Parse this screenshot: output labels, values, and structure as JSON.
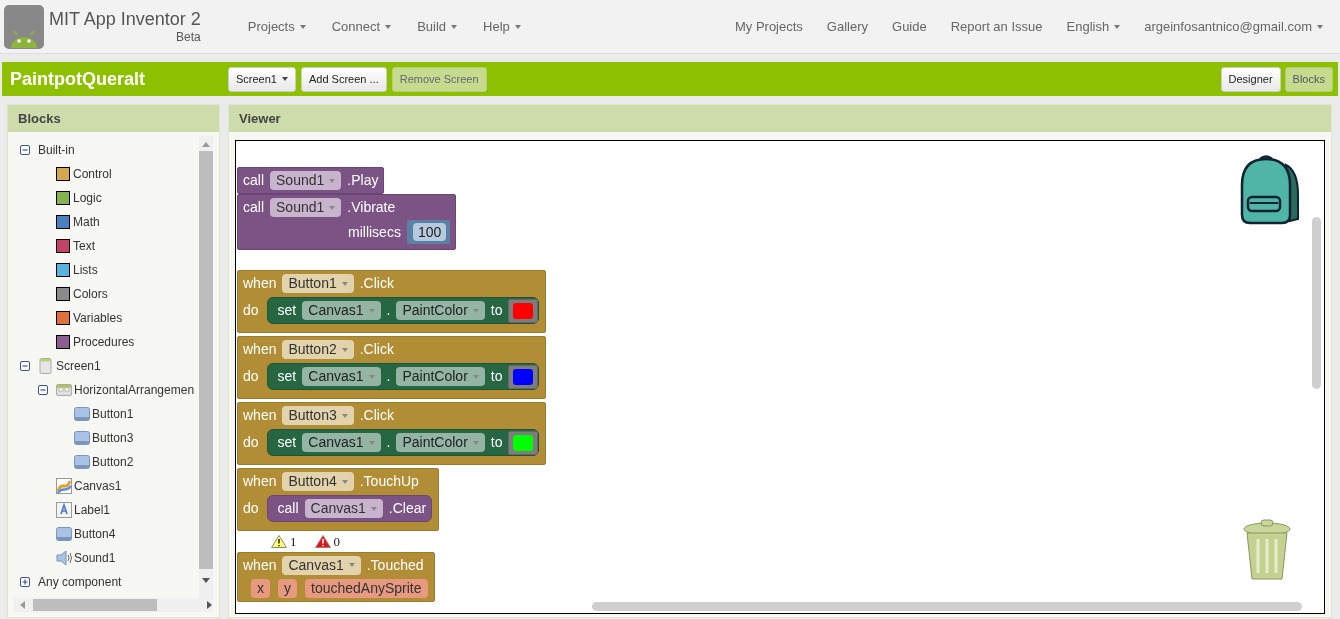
{
  "header": {
    "title": "MIT App Inventor 2",
    "subtitle": "Beta",
    "menus": [
      {
        "label": "Projects",
        "dropdown": true
      },
      {
        "label": "Connect",
        "dropdown": true
      },
      {
        "label": "Build",
        "dropdown": true
      },
      {
        "label": "Help",
        "dropdown": true
      }
    ],
    "links": [
      {
        "label": "My Projects",
        "dropdown": false
      },
      {
        "label": "Gallery",
        "dropdown": false
      },
      {
        "label": "Guide",
        "dropdown": false
      },
      {
        "label": "Report an Issue",
        "dropdown": false
      },
      {
        "label": "English",
        "dropdown": true
      },
      {
        "label": "argeinfosantnico@gmail.com",
        "dropdown": true
      }
    ]
  },
  "toolbar": {
    "project": "PaintpotQueralt",
    "buttons": [
      {
        "label": "Screen1",
        "dropdown": true,
        "disabled": false
      },
      {
        "label": "Add Screen ...",
        "dropdown": false,
        "disabled": false
      },
      {
        "label": "Remove Screen",
        "dropdown": false,
        "disabled": true
      }
    ],
    "views": [
      {
        "label": "Designer",
        "selected": false
      },
      {
        "label": "Blocks",
        "selected": true
      }
    ]
  },
  "blocks_panel": {
    "title": "Blocks",
    "tree": [
      {
        "label": "Built-in",
        "expanded": true,
        "children": [
          {
            "label": "Control",
            "color": "#d4a94b"
          },
          {
            "label": "Logic",
            "color": "#84b350"
          },
          {
            "label": "Math",
            "color": "#4a7fc1"
          },
          {
            "label": "Text",
            "color": "#c4416a"
          },
          {
            "label": "Lists",
            "color": "#55b3dd"
          },
          {
            "label": "Colors",
            "color": "#8a8a8a"
          },
          {
            "label": "Variables",
            "color": "#e06f3a"
          },
          {
            "label": "Procedures",
            "color": "#8c5f93"
          }
        ]
      },
      {
        "label": "Screen1",
        "kind": "screen",
        "expanded": true,
        "children": [
          {
            "label": "HorizontalArrangemen",
            "kind": "arrangement",
            "expanded": true,
            "children": [
              {
                "label": "Button1",
                "kind": "button"
              },
              {
                "label": "Button3",
                "kind": "button"
              },
              {
                "label": "Button2",
                "kind": "button"
              }
            ]
          },
          {
            "label": "Canvas1",
            "kind": "canvas"
          },
          {
            "label": "Label1",
            "kind": "label"
          },
          {
            "label": "Button4",
            "kind": "button"
          },
          {
            "label": "Sound1",
            "kind": "sound"
          }
        ]
      },
      {
        "label": "Any component",
        "expanded": false
      }
    ]
  },
  "viewer": {
    "title": "Viewer",
    "blocks": [
      {
        "kind": "method",
        "keyword": "call",
        "component": "Sound1",
        "method": ".Play"
      },
      {
        "kind": "method",
        "keyword": "call",
        "component": "Sound1",
        "method": ".Vibrate",
        "param_label": "millisecs",
        "param_value": "100"
      },
      {
        "kind": "event",
        "keyword": "when",
        "component": "Button1",
        "event": ".Click",
        "do_label": "do",
        "body": {
          "kind": "setter",
          "keyword": "set",
          "component": "Canvas1",
          "dot": ".",
          "property": "PaintColor",
          "to_label": "to",
          "color": "#ff0000"
        }
      },
      {
        "kind": "event",
        "keyword": "when",
        "component": "Button2",
        "event": ".Click",
        "do_label": "do",
        "body": {
          "kind": "setter",
          "keyword": "set",
          "component": "Canvas1",
          "dot": ".",
          "property": "PaintColor",
          "to_label": "to",
          "color": "#0000ff"
        }
      },
      {
        "kind": "event",
        "keyword": "when",
        "component": "Button3",
        "event": ".Click",
        "do_label": "do",
        "body": {
          "kind": "setter",
          "keyword": "set",
          "component": "Canvas1",
          "dot": ".",
          "property": "PaintColor",
          "to_label": "to",
          "color": "#00ff00"
        }
      },
      {
        "kind": "event",
        "keyword": "when",
        "component": "Button4",
        "event": ".TouchUp",
        "do_label": "do",
        "body": {
          "kind": "method",
          "keyword": "call",
          "component": "Canvas1",
          "method": ".Clear"
        }
      },
      {
        "kind": "status",
        "warnings": "1",
        "errors": "0"
      },
      {
        "kind": "event",
        "keyword": "when",
        "component": "Canvas1",
        "event": ".Touched",
        "params": [
          "x",
          "y",
          "touchedAnySprite"
        ]
      }
    ]
  }
}
